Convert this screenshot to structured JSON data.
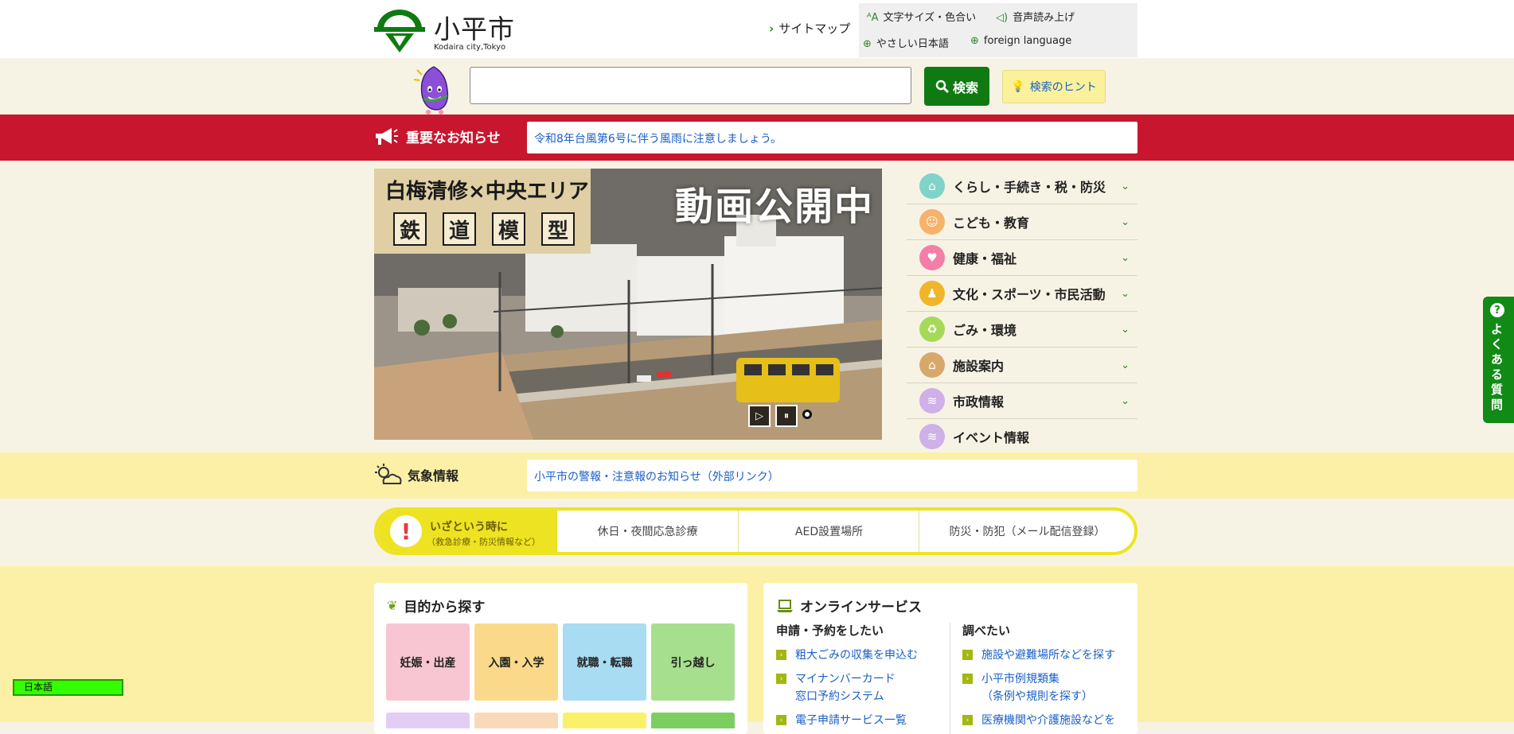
{
  "header": {
    "logo_ja": "小平市",
    "logo_en": "Kodaira city,Tokyo",
    "sitemap": "サイトマップ",
    "tools": {
      "font_color": "文字サイズ・色合い",
      "read_aloud": "音声読み上げ",
      "easy_japanese": "やさしい日本語",
      "foreign_language": "foreign language"
    }
  },
  "search": {
    "value": "",
    "button": "検索",
    "hint": "検索のヒント"
  },
  "notice": {
    "title": "重要なお知らせ",
    "link": "令和8年台風第6号に伴う風雨に注意しましょう。"
  },
  "hero": {
    "badge_top": "白梅清修×中央エリア",
    "badge_kanji": [
      "鉄",
      "道",
      "模",
      "型"
    ],
    "title": "動画公開中",
    "play": "▷",
    "pause": "⏸"
  },
  "categories": [
    {
      "label": "くらし・手続き・税・防災",
      "icon": "house-icon",
      "color": "#7fd3c8",
      "glyph": "⌂",
      "expandable": true
    },
    {
      "label": "こども・教育",
      "icon": "child-face-icon",
      "color": "#f7b26a",
      "glyph": "☺",
      "expandable": true
    },
    {
      "label": "健康・福祉",
      "icon": "heart-icon",
      "color": "#f37fa6",
      "glyph": "♥",
      "expandable": true
    },
    {
      "label": "文化・スポーツ・市民活動",
      "icon": "people-icon",
      "color": "#f1b52a",
      "glyph": "♟",
      "expandable": true
    },
    {
      "label": "ごみ・環境",
      "icon": "recycle-icon",
      "color": "#a6d95a",
      "glyph": "♻",
      "expandable": true
    },
    {
      "label": "施設案内",
      "icon": "building-icon",
      "color": "#d8a86a",
      "glyph": "⌂",
      "expandable": true
    },
    {
      "label": "市政情報",
      "icon": "info-icon",
      "color": "#cfb0e8",
      "glyph": "≋",
      "expandable": true
    },
    {
      "label": "イベント情報",
      "icon": "event-icon",
      "color": "#cfb0e8",
      "glyph": "≋",
      "expandable": false
    }
  ],
  "weather": {
    "title": "気象情報",
    "link": "小平市の警報・注意報のお知らせ（外部リンク）"
  },
  "emergency": {
    "title": "いざという時に",
    "subtitle": "（救急診療・防災情報など）",
    "links": [
      "休日・夜間応急診療",
      "AED設置場所",
      "防災・防犯（メール配信登録）"
    ]
  },
  "purpose": {
    "title": "目的から探す",
    "tiles": [
      {
        "label": "妊娠・出産",
        "color": "#f8c6d2"
      },
      {
        "label": "入園・入学",
        "color": "#fbd98a"
      },
      {
        "label": "就職・転職",
        "color": "#a8dcf2"
      },
      {
        "label": "引っ越し",
        "color": "#a6e08e"
      }
    ],
    "row2_colors": [
      "#e4cdf4",
      "#f9d9b8",
      "#fbf06a",
      "#7ccf5e"
    ]
  },
  "online": {
    "title": "オンラインサービス",
    "col1_title": "申請・予約をしたい",
    "col1_links": [
      "粗大ごみの収集を申込む",
      "マイナンバーカード\n窓口予約システム",
      "電子申請サービス一覧"
    ],
    "col2_title": "調べたい",
    "col2_links": [
      "施設や避難場所などを探す",
      "小平市例規類集\n（条例や規則を探す）",
      "医療機関や介護施設などを"
    ]
  },
  "faq": {
    "mark": "?",
    "label": "よくある質問"
  },
  "language": {
    "selected": "日本語"
  }
}
